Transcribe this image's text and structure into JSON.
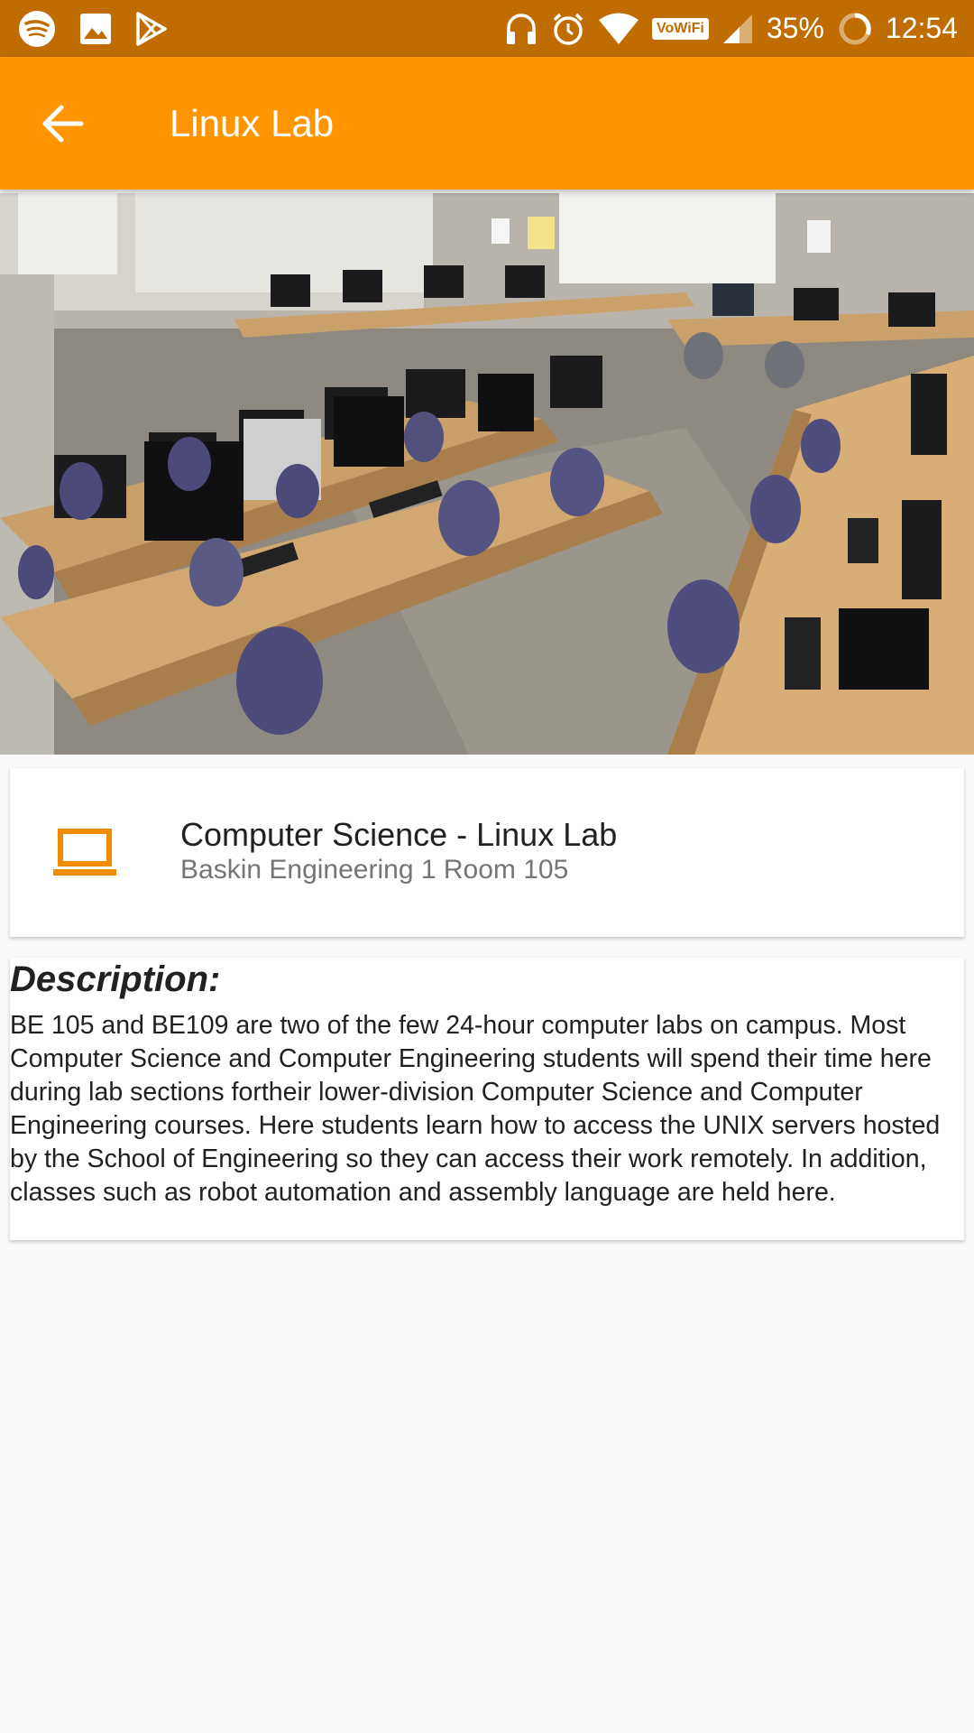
{
  "status_bar": {
    "left_icons": [
      "spotify-icon",
      "gallery-icon",
      "play-store-icon"
    ],
    "right_icons": [
      "headphones-icon",
      "alarm-icon",
      "wifi-icon",
      "signal-icon",
      "battery-icon"
    ],
    "wifi_tag": "VoWiFi",
    "battery_percent": "35%",
    "time": "12:54",
    "background_color": "#bf6c00"
  },
  "app_bar": {
    "title": "Linux Lab",
    "back_icon": "arrow-back-icon",
    "background_color": "#ff9500"
  },
  "hero_image": {
    "subject": "computer-lab-photo"
  },
  "info_card": {
    "icon": "laptop-icon",
    "icon_color": "#f08c00",
    "title": "Computer Science - Linux Lab",
    "subtitle": "Baskin Engineering 1 Room 105"
  },
  "description": {
    "heading": "Description:",
    "body": "BE 105 and BE109 are two of the few 24-hour computer labs on campus. Most Computer Science and Computer Engineering students will spend their time here during lab sections fortheir lower-division Computer Science and Computer Engineering courses. Here students learn how to access the UNIX servers hosted by the School of Engineering so they can access their work remotely. In addition, classes such as robot automation and assembly language are held here."
  }
}
